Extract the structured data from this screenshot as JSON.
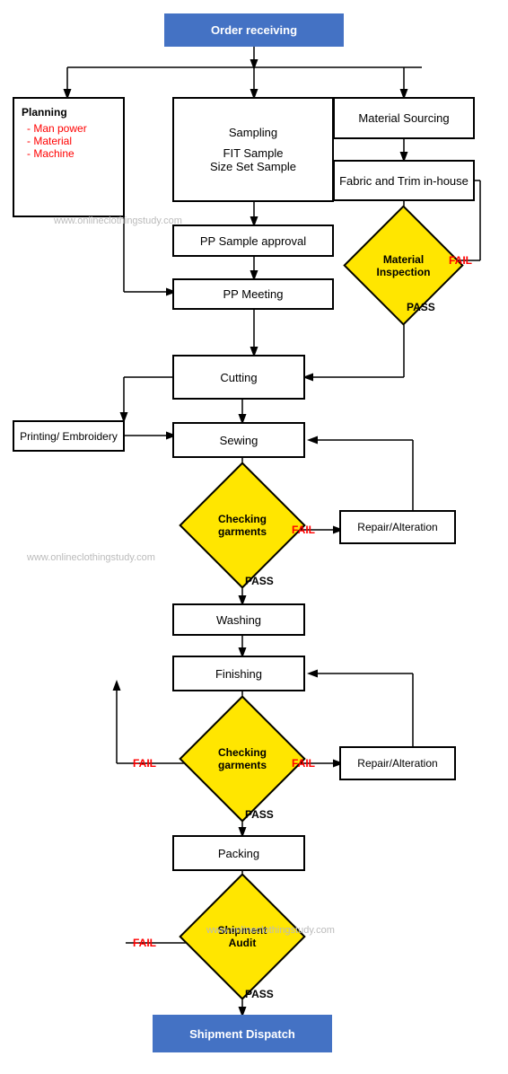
{
  "nodes": {
    "order_receiving": {
      "label": "Order receiving"
    },
    "planning": {
      "label": "Planning\n- Man power\n- Material\n- Machine"
    },
    "sampling": {
      "label": "Sampling\n\nFIT Sample\nSize Set Sample"
    },
    "material_sourcing": {
      "label": "Material Sourcing"
    },
    "fabric_trim": {
      "label": "Fabric and Trim in-house"
    },
    "material_inspection": {
      "label": "Material\nInspection"
    },
    "pp_sample": {
      "label": "PP Sample approval"
    },
    "pp_meeting": {
      "label": "PP Meeting"
    },
    "cutting": {
      "label": "Cutting"
    },
    "printing": {
      "label": "Printing/ Embroidery"
    },
    "sewing": {
      "label": "Sewing"
    },
    "checking1": {
      "label": "Checking\ngarments"
    },
    "repair1": {
      "label": "Repair/Alteration"
    },
    "washing": {
      "label": "Washing"
    },
    "finishing": {
      "label": "Finishing"
    },
    "checking2": {
      "label": "Checking\ngarments"
    },
    "repair2": {
      "label": "Repair/Alteration"
    },
    "packing": {
      "label": "Packing"
    },
    "shipment_audit": {
      "label": "Shipment\nAudit"
    },
    "shipment_dispatch": {
      "label": "Shipment Dispatch"
    }
  },
  "labels": {
    "fail": "FAIL",
    "pass": "PASS",
    "watermark1": "www.onlineclothingstudy.com",
    "watermark2": "www.onlineclothingstudy.com",
    "watermark3": "www.onlineclothingstudy.com"
  }
}
